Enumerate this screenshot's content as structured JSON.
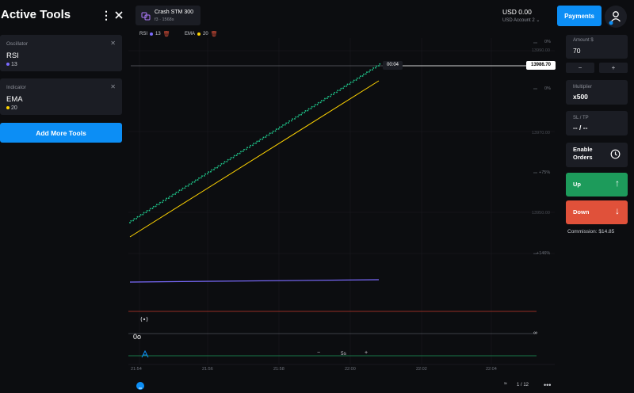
{
  "left_panel": {
    "title": "Active Tools",
    "tools": [
      {
        "caption": "Oscillator",
        "name": "RSI",
        "param": "13",
        "color": "#7b6bff"
      },
      {
        "caption": "Indicator",
        "name": "EMA",
        "param": "20",
        "color": "#ffd400"
      }
    ],
    "add_button": "Add More Tools"
  },
  "asset": {
    "name": "Crash STM 300",
    "subtitle": "f3 · 1568s"
  },
  "indicator_chips": [
    {
      "label": "RSI",
      "value": "13",
      "color": "#7b6bff"
    },
    {
      "label": "EMA",
      "value": "20",
      "color": "#ffd400"
    }
  ],
  "header": {
    "balance": "USD 0.00",
    "account": "USD Account 2",
    "payments_label": "Payments"
  },
  "chart": {
    "pct_labels": [
      "0%",
      "0%",
      "+75%",
      "+146%"
    ],
    "price_ticks": [
      "13990.00",
      "13970.00",
      "13950.00"
    ],
    "current_time": "00:04",
    "current_price": "13986.70",
    "time_labels": [
      "21:54",
      "21:56",
      "21:58",
      "22:00",
      "22:02",
      "22:04"
    ],
    "osc_value": "0o",
    "zoom_label": "5s",
    "page_indicator": "1 / 12",
    "colors": {
      "price_dots": "#1fc188",
      "ema": "#ffd400",
      "rsi": "#7b6bff"
    }
  },
  "right_panel": {
    "amount_caption": "Amount $",
    "amount_value": "70",
    "multiplier_caption": "Multiplier",
    "multiplier_value": "x500",
    "sltp_caption": "SL / TP",
    "sltp_value": "-- / --",
    "enable_orders": "Enable Orders",
    "up_label": "Up",
    "down_label": "Down",
    "commission": "Commission: $14.85"
  }
}
